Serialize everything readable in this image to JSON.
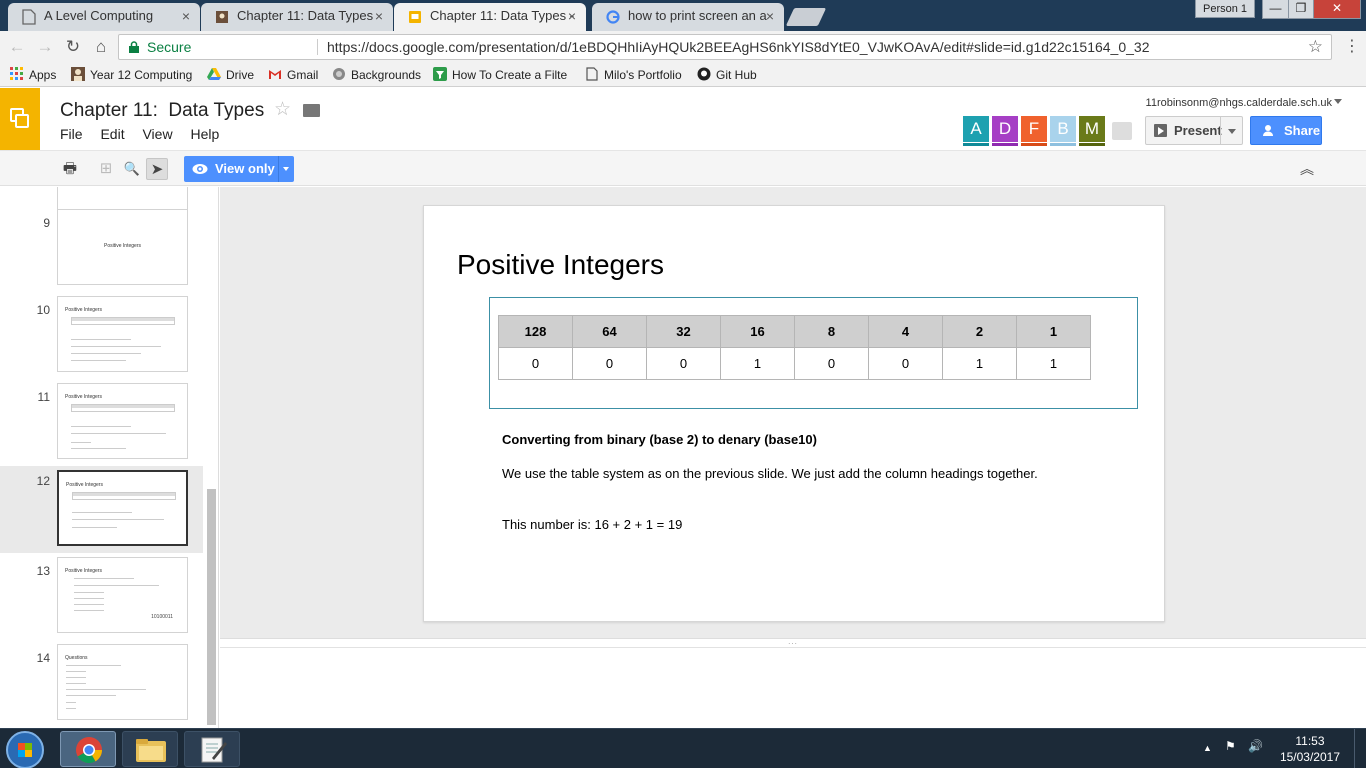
{
  "browser": {
    "tabs": [
      {
        "title": "A Level Computing",
        "close": "×"
      },
      {
        "title": "Chapter 11: Data Types",
        "close": "×"
      },
      {
        "title": "Chapter 11: Data Types -",
        "close": "×"
      },
      {
        "title": "how to print screen an a",
        "close": "×"
      }
    ],
    "profile": "Person 1",
    "window_buttons": {
      "minimize": "—",
      "maximize": "❐",
      "close": "✕"
    },
    "nav": {
      "back": "←",
      "forward": "→",
      "reload": "↻",
      "home": "⌂"
    },
    "secure_label": "Secure",
    "url": "https://docs.google.com/presentation/d/1eBDQHhIiAyHQUk2BEEAgHS6nkYIS8dYtE0_VJwKOAvA/edit#slide=id.g1d22c15164_0_32",
    "star": "☆",
    "menu": "⋮"
  },
  "bookmarks": {
    "items": [
      {
        "label": "Apps",
        "icon": "apps-grid-icon"
      },
      {
        "label": "Year 12 Computing",
        "icon": "avatar-icon"
      },
      {
        "label": "Drive",
        "icon": "drive-icon"
      },
      {
        "label": "Gmail",
        "icon": "gmail-icon"
      },
      {
        "label": "Backgrounds",
        "icon": "globe-icon"
      },
      {
        "label": "How To Create a Filte",
        "icon": "filter-icon"
      },
      {
        "label": "Milo's Portfolio",
        "icon": "page-icon"
      },
      {
        "label": "Git Hub",
        "icon": "github-icon"
      }
    ]
  },
  "doc": {
    "title": "Chapter 11:  Data Types",
    "menu": [
      "File",
      "Edit",
      "View",
      "Help"
    ],
    "account": "11robinsonm@nhgs.calderdale.sch.uk",
    "collaborators": [
      {
        "letter": "A",
        "color": "#1ea1b0",
        "bar": "#0f8a98"
      },
      {
        "letter": "D",
        "color": "#a63fc5",
        "bar": "#8f2ab0"
      },
      {
        "letter": "F",
        "color": "#f0612d",
        "bar": "#d84b17"
      },
      {
        "letter": "B",
        "color": "#a9d3ec",
        "bar": "#8ec0df"
      },
      {
        "letter": "M",
        "color": "#6a7a19",
        "bar": "#56650f"
      }
    ],
    "present_label": "Present",
    "share_label": "Share",
    "view_only_label": "View only",
    "accent": "#4d90fe",
    "brand": "#f4b400"
  },
  "toolbar": {
    "print": "🖶",
    "new_slide": "⊞",
    "zoom": "🔍",
    "select": "➤",
    "collapse": "︽"
  },
  "filmstrip": {
    "slides": [
      {
        "num": "9",
        "title": "Positive Integers"
      },
      {
        "num": "10",
        "title": "Positive Integers"
      },
      {
        "num": "11",
        "title": "Positive Integers"
      },
      {
        "num": "12",
        "title": "Positive Integers"
      },
      {
        "num": "13",
        "title": "Positive Integers",
        "extra": "10100011"
      },
      {
        "num": "14",
        "title": "Questions"
      }
    ]
  },
  "slide": {
    "title": "Positive Integers",
    "table_headers": [
      "128",
      "64",
      "32",
      "16",
      "8",
      "4",
      "2",
      "1"
    ],
    "table_values": [
      "0",
      "0",
      "0",
      "1",
      "0",
      "0",
      "1",
      "1"
    ],
    "heading": "Converting from binary (base 2) to denary (base10)",
    "paragraph": "We use the table system as on the previous slide.  We just add the column headings together.",
    "result": "This number is:  16 + 2 + 1 = 19"
  },
  "notes_handle": "...",
  "taskbar": {
    "tray_up": "▲",
    "tray_flag": "⚑",
    "tray_volume": "🔊",
    "time": "11:53",
    "date": "15/03/2017"
  }
}
